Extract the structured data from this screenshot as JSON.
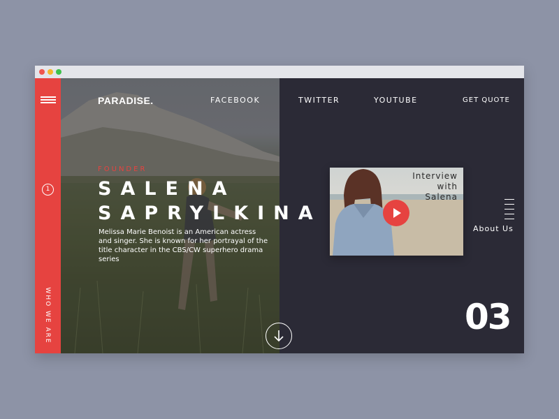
{
  "brand": {
    "logo": "PARADISE."
  },
  "nav": {
    "facebook": "FACEBOOK",
    "twitter": "TWITTER",
    "youtube": "YOUTUBE",
    "get_quote": "GET QUOTE"
  },
  "sidebar": {
    "step": "1",
    "section_label": "WHO WE ARE"
  },
  "hero": {
    "role": "FOUNDER",
    "first_name": "SALENA",
    "last_name": "SAPRYLKINA",
    "bio": "Melissa Marie Benoist is an American actress and singer. She is known for her portrayal of the title character in the CBS/CW superhero drama series"
  },
  "video": {
    "title_line1": "Interview",
    "title_line2": "with",
    "title_line3": "Salena"
  },
  "side_nav": {
    "about": "About Us"
  },
  "slide": {
    "number": "03"
  },
  "colors": {
    "accent": "#e64340",
    "panel": "#2b2a36",
    "page_bg": "#8d93a6"
  },
  "icons": {
    "menu": "hamburger-icon",
    "play": "play-icon",
    "scroll": "arrow-down-icon",
    "lines": "lines-icon"
  }
}
